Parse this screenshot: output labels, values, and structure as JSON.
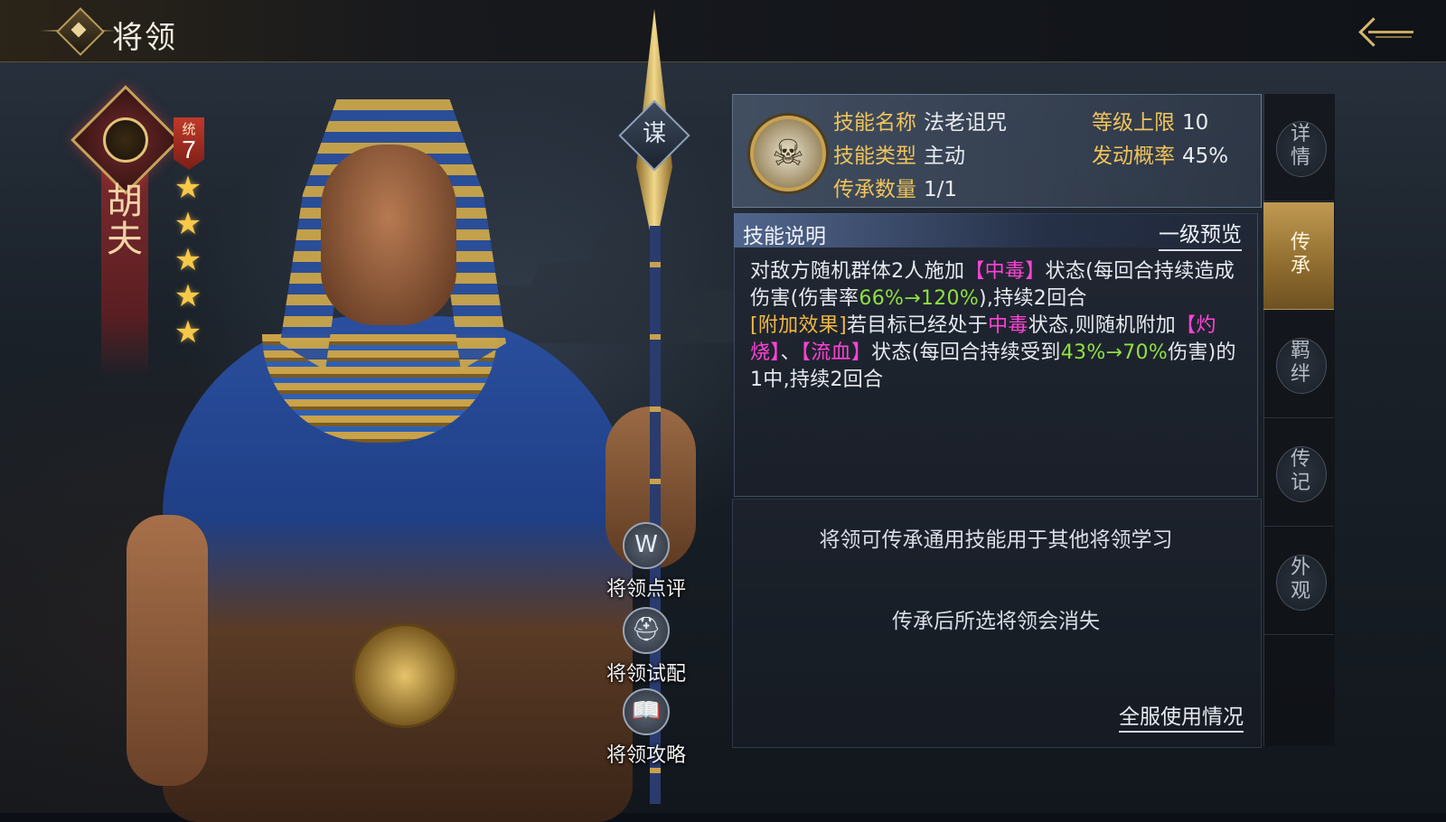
{
  "header": {
    "title": "将领"
  },
  "general": {
    "name": "胡\n夫",
    "command_label": "统",
    "command_value": "7",
    "stars": 5,
    "strategy_badge": "谋"
  },
  "side_actions": [
    {
      "label": "将领点评",
      "icon": "review-icon"
    },
    {
      "label": "将领试配",
      "icon": "helmet-icon"
    },
    {
      "label": "将领攻略",
      "icon": "book-icon"
    }
  ],
  "skill": {
    "name_label": "技能名称",
    "name_value": "法老诅咒",
    "type_label": "技能类型",
    "type_value": "主动",
    "inherit_label": "传承数量",
    "inherit_value": "1/1",
    "level_label": "等级上限",
    "level_value": "10",
    "prob_label": "发动概率",
    "prob_value": "45%"
  },
  "description": {
    "title": "技能说明",
    "preview_link": "一级预览",
    "segments": [
      {
        "t": "对敌方随机群体2人施加",
        "c": ""
      },
      {
        "t": "【中毒】",
        "c": "magenta"
      },
      {
        "t": "状态(每回合持续造成伤害(伤害率",
        "c": ""
      },
      {
        "t": "66%→120%",
        "c": "green"
      },
      {
        "t": "),持续2回合",
        "c": ""
      },
      {
        "t": "\n",
        "c": ""
      },
      {
        "t": "[附加效果]",
        "c": "gold"
      },
      {
        "t": "若目标已经处于",
        "c": ""
      },
      {
        "t": "中毒",
        "c": "magenta"
      },
      {
        "t": "状态,则随机附加",
        "c": ""
      },
      {
        "t": "【灼烧】",
        "c": "magenta"
      },
      {
        "t": "、",
        "c": ""
      },
      {
        "t": "【流血】",
        "c": "magenta"
      },
      {
        "t": "状态(每回合持续受到",
        "c": ""
      },
      {
        "t": "43%→70%",
        "c": "green"
      },
      {
        "t": "伤害)的1中,持续2回合",
        "c": ""
      }
    ]
  },
  "notes": {
    "line1": "将领可传承通用技能用于其他将领学习",
    "line2": "传承后所选将领会消失",
    "usage_link": "全服使用情况"
  },
  "tabs": [
    {
      "label": "详\n情",
      "active": false
    },
    {
      "label": "传\n承",
      "active": true
    },
    {
      "label": "羁\n绊",
      "active": false
    },
    {
      "label": "传\n记",
      "active": false
    },
    {
      "label": "外\n观",
      "active": false
    }
  ],
  "colors": {
    "gold_label": "#f0c35a",
    "status_magenta": "#ff43d6",
    "value_green": "#8fe040",
    "active_tab": "#c09a52"
  }
}
